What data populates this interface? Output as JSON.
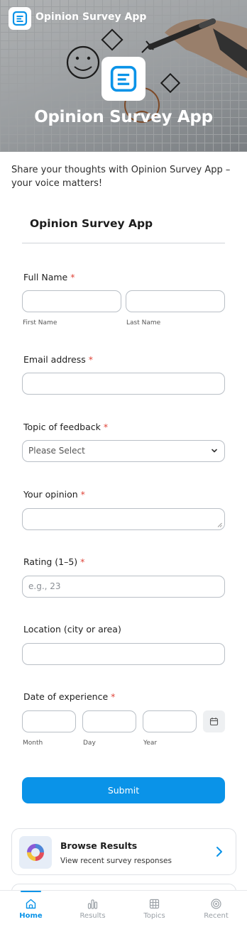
{
  "app": {
    "title": "Opinion Survey App",
    "hero_title": "Opinion Survey App",
    "intro": "Share your thoughts with Opinion Survey App – your voice matters!"
  },
  "colors": {
    "accent": "#0a93e8",
    "required": "#e0453a",
    "border": "#b9bfc6"
  },
  "form": {
    "heading": "Opinion Survey App",
    "required_mark": "*",
    "full_name": {
      "label": "Full Name",
      "first_sub": "First Name",
      "last_sub": "Last Name",
      "first_value": "",
      "last_value": ""
    },
    "email": {
      "label": "Email address",
      "value": ""
    },
    "topic": {
      "label": "Topic of feedback",
      "selected": "Please Select"
    },
    "opinion": {
      "label": "Your opinion",
      "value": ""
    },
    "rating": {
      "label": "Rating (1–5)",
      "placeholder": "e.g., 23"
    },
    "location": {
      "label": "Location (city or area)",
      "value": ""
    },
    "date": {
      "label": "Date of experience",
      "month_sub": "Month",
      "day_sub": "Day",
      "year_sub": "Year",
      "icon": "calendar-icon"
    },
    "submit_label": "Submit"
  },
  "cards": [
    {
      "title": "Browse Results",
      "subtitle": "View recent survey responses",
      "icon": "donut-chart-icon"
    }
  ],
  "tabs": [
    {
      "label": "Home",
      "icon": "home-icon",
      "active": true
    },
    {
      "label": "Results",
      "icon": "bar-chart-icon",
      "active": false
    },
    {
      "label": "Topics",
      "icon": "grid-icon",
      "active": false
    },
    {
      "label": "Recent",
      "icon": "target-icon",
      "active": false
    }
  ]
}
